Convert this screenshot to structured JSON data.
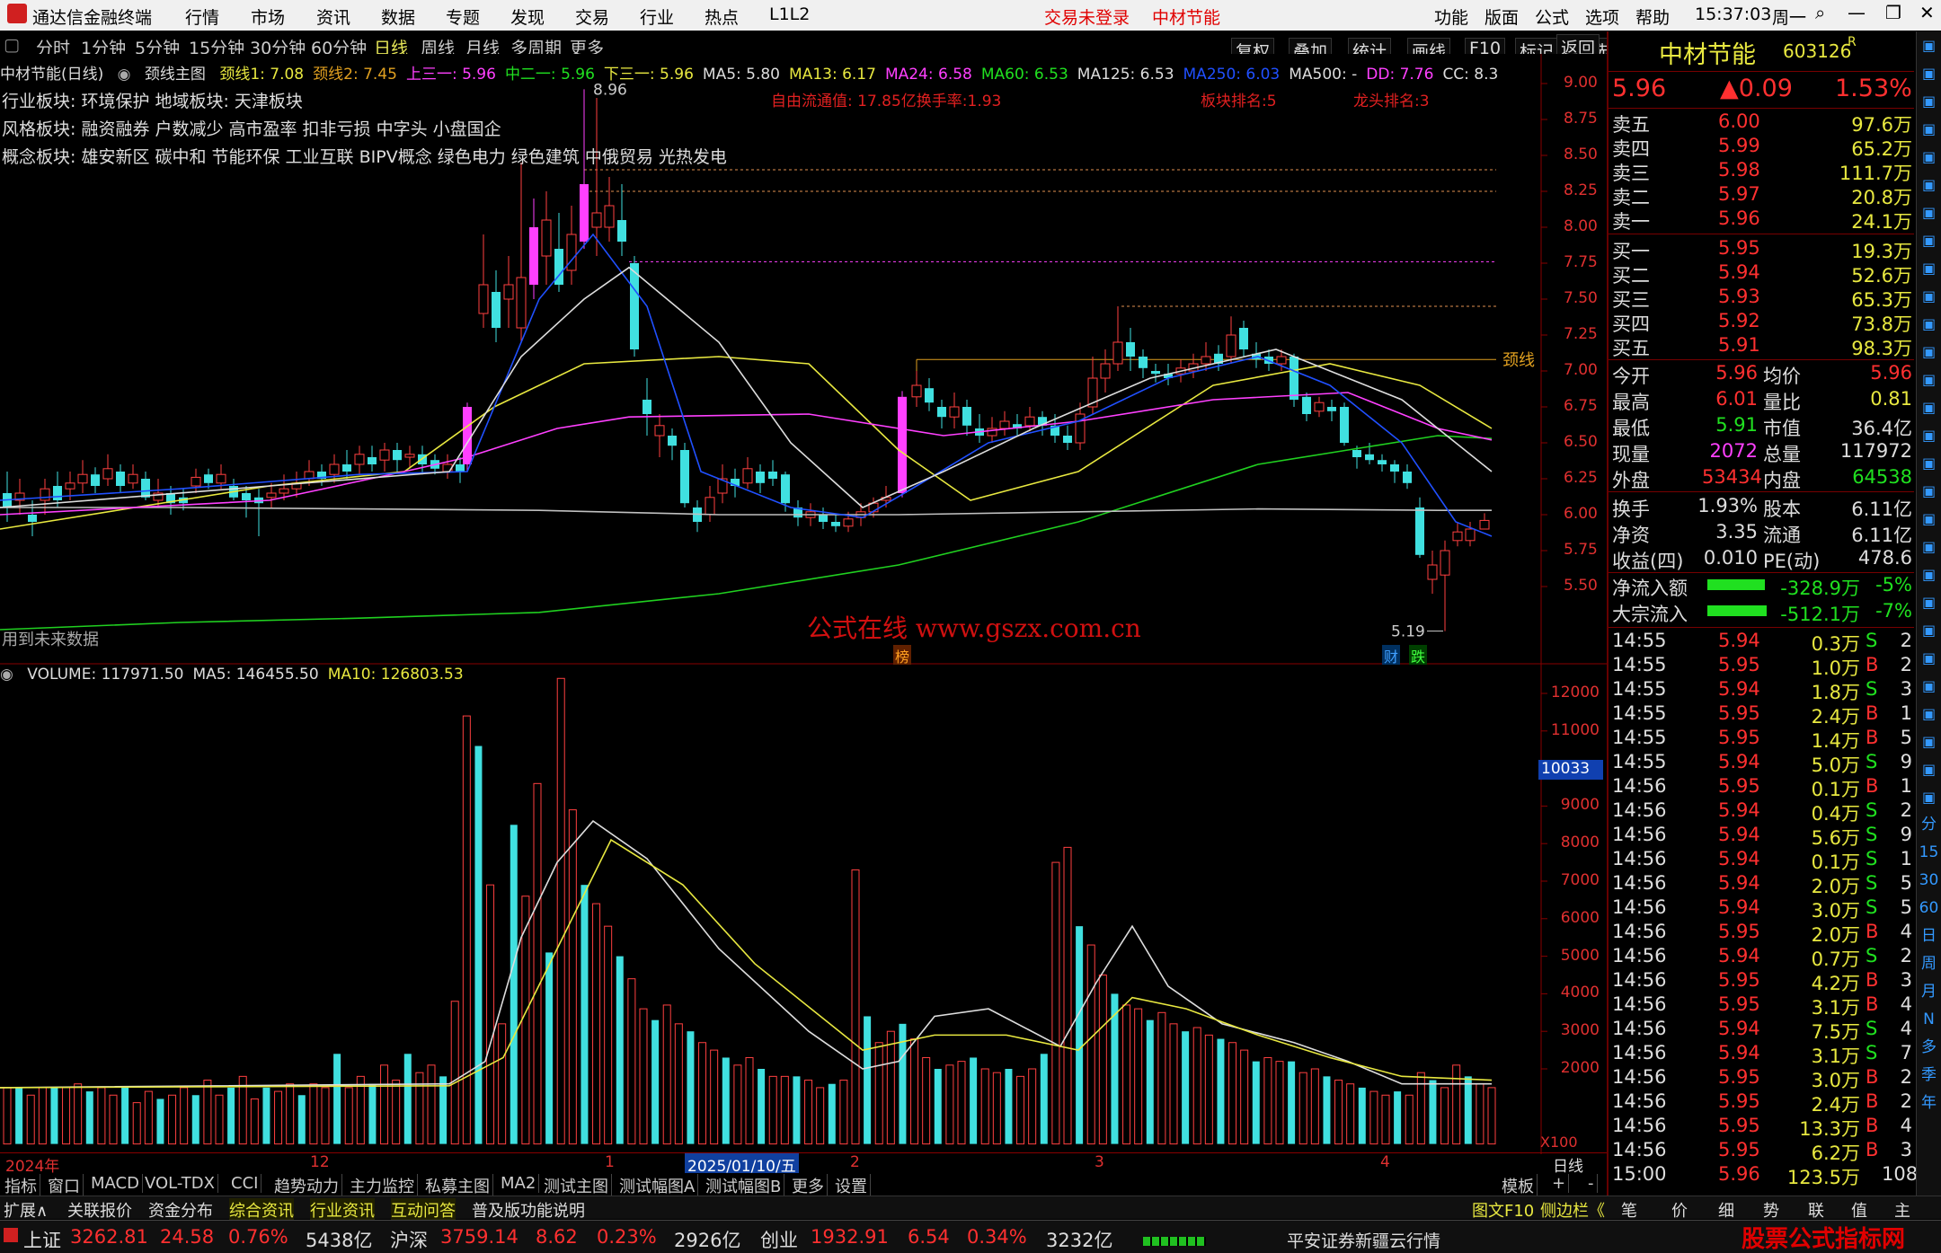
{
  "titlebar": {
    "app": "通达信金融终端",
    "menu": [
      "行情",
      "市场",
      "资讯",
      "数据",
      "专题",
      "发现",
      "交易",
      "行业",
      "热点",
      "L1L2"
    ],
    "notice": "交易未登录",
    "stock": "中材节能",
    "right_menu": [
      "功能",
      "版面",
      "公式",
      "选项",
      "帮助"
    ],
    "time": "15:37:03",
    "weekday": "周一"
  },
  "periods": [
    "分时",
    "1分钟",
    "5分钟",
    "15分钟",
    "30分钟",
    "60分钟",
    "日线",
    "周线",
    "月线",
    "多周期",
    "更多"
  ],
  "tools": [
    "复权",
    "叠加",
    "统计",
    "画线",
    "F10",
    "标记",
    "-自选",
    "返回"
  ],
  "chart_title": "中材节能(日线)",
  "indicator_name": "颈线主图",
  "ma_values": [
    {
      "t": "颈线1: 7.08",
      "c": "#e8e840"
    },
    {
      "t": "颈线2: 7.45",
      "c": "#e0a020"
    },
    {
      "t": "上三一: 5.96",
      "c": "#ff40ff"
    },
    {
      "t": "中二一: 5.96",
      "c": "#20e020"
    },
    {
      "t": "下三一: 5.96",
      "c": "#e8e840"
    },
    {
      "t": "MA5: 5.80",
      "c": "#dddddd"
    },
    {
      "t": "MA13: 6.17",
      "c": "#e8e840"
    },
    {
      "t": "MA24: 6.58",
      "c": "#ff40ff"
    },
    {
      "t": "MA60: 6.53",
      "c": "#20e020"
    },
    {
      "t": "MA125: 6.53",
      "c": "#dddddd"
    },
    {
      "t": "MA250: 6.03",
      "c": "#2050ff"
    },
    {
      "t": "MA500: -",
      "c": "#dddddd"
    },
    {
      "t": "DD: 7.76",
      "c": "#ff40ff"
    },
    {
      "t": "CC: 8.3",
      "c": "#dddddd"
    }
  ],
  "sectors": {
    "industry": "行业板块: 环境保护    地域板块: 天津板块",
    "style": "风格板块: 融资融券 户数减少 高市盈率 扣非亏损 中字头 小盘国企",
    "concept": "概念板块: 雄安新区 碳中和 节能环保 工业互联 BIPV概念 绿色电力 绿色建筑 中俄贸易 光热发电"
  },
  "capital_info": {
    "float": "自由流通值: 17.85亿换手率:1.93",
    "sector_rank": "板块排名:5",
    "leader_rank": "龙头排名:3"
  },
  "price_axis": [
    "9.00",
    "8.75",
    "8.50",
    "8.25",
    "8.00",
    "7.75",
    "7.50",
    "7.25",
    "7.00",
    "6.75",
    "6.50",
    "6.25",
    "6.00",
    "5.75",
    "5.50"
  ],
  "high_label": "8.96",
  "low_label": "5.19",
  "neckline_label": "颈线",
  "watermark": "公式在线  www.gszx.com.cn",
  "future_data": "用到未来数据",
  "markers": {
    "bang": "榜",
    "cai": "财",
    "die": "跌"
  },
  "volume": {
    "header": [
      {
        "t": "VOLUME: 117971.50",
        "c": "#dddddd"
      },
      {
        "t": "MA5: 146455.50",
        "c": "#dddddd"
      },
      {
        "t": "MA10: 126803.53",
        "c": "#e8e840"
      }
    ],
    "axis": [
      "12000",
      "11000",
      "10000",
      "9000",
      "8000",
      "7000",
      "6000",
      "5000",
      "4000",
      "3000",
      "2000"
    ],
    "current": "10033",
    "unit": "X100"
  },
  "xaxis": {
    "y2024": "2024年",
    "m12": "12",
    "m1": "1",
    "cursor_date": "2025/01/10/五",
    "m2": "2",
    "m3": "3",
    "m4": "4",
    "period": "日线"
  },
  "tabs1": [
    "指标",
    "窗口",
    "MACD",
    "VOL-TDX",
    "CCI",
    "趋势动力",
    "主力监控",
    "私募主图",
    "MA2",
    "测试主图",
    "测试幅图A",
    "测试幅图B",
    "更多",
    "设置"
  ],
  "tabs1_right": [
    "模板",
    "+",
    "-"
  ],
  "tabs2": [
    "扩展∧",
    "关联报价",
    "资金分布",
    "综合资讯",
    "行业资讯",
    "互动问答",
    "普及版功能说明"
  ],
  "tabs2_right": [
    "图文F10",
    "侧边栏《",
    "笔",
    "价",
    "细",
    "势",
    "联",
    "值",
    "主"
  ],
  "status": {
    "sh_name": "上证",
    "sh_val": "3262.81",
    "sh_chg": "24.58",
    "sh_pct": "0.76%",
    "sh_amt": "5438亿",
    "sz_name": "沪深",
    "sz_val": "3759.14",
    "sz_chg": "8.62",
    "sz_pct": "0.23%",
    "sz_amt": "2926亿",
    "cy_name": "创业",
    "cy_val": "1932.91",
    "cy_chg": "6.54",
    "cy_pct": "0.34%",
    "cy_amt": "3232亿",
    "broker": "平安证券新疆云行情",
    "site": "股票公式指标网",
    "site_url": "www.gszx.com.cn"
  },
  "quote": {
    "name": "中材节能",
    "code": "603126",
    "flag": "R",
    "price": "5.96",
    "change": "▲0.09",
    "pct": "1.53%",
    "sell": [
      {
        "l": "卖五",
        "p": "6.00",
        "v": "97.6万"
      },
      {
        "l": "卖四",
        "p": "5.99",
        "v": "65.2万"
      },
      {
        "l": "卖三",
        "p": "5.98",
        "v": "111.7万"
      },
      {
        "l": "卖二",
        "p": "5.97",
        "v": "20.8万"
      },
      {
        "l": "卖一",
        "p": "5.96",
        "v": "24.1万"
      }
    ],
    "buy": [
      {
        "l": "买一",
        "p": "5.95",
        "v": "19.3万"
      },
      {
        "l": "买二",
        "p": "5.94",
        "v": "52.6万"
      },
      {
        "l": "买三",
        "p": "5.93",
        "v": "65.3万"
      },
      {
        "l": "买四",
        "p": "5.92",
        "v": "73.8万"
      },
      {
        "l": "买五",
        "p": "5.91",
        "v": "98.3万"
      }
    ],
    "stats": [
      [
        "今开",
        "5.96",
        "均价",
        "5.96"
      ],
      [
        "最高",
        "6.01",
        "量比",
        "0.81"
      ],
      [
        "最低",
        "5.91",
        "市值",
        "36.4亿"
      ],
      [
        "现量",
        "2072",
        "总量",
        "117972"
      ],
      [
        "外盘",
        "53434",
        "内盘",
        "64538"
      ]
    ],
    "stats2": [
      [
        "换手",
        "1.93%",
        "股本",
        "6.11亿"
      ],
      [
        "净资",
        "3.35",
        "流通",
        "6.11亿"
      ],
      [
        "收益(四)",
        "0.010",
        "PE(动)",
        "478.6"
      ]
    ],
    "flow": [
      {
        "l": "净流入额",
        "v": "-328.9万",
        "p": "-5%"
      },
      {
        "l": "大宗流入",
        "v": "-512.1万",
        "p": "-7%"
      }
    ],
    "ticks": [
      [
        "14:55",
        "5.94",
        "0.3万",
        "S",
        "2"
      ],
      [
        "14:55",
        "5.95",
        "1.0万",
        "B",
        "2"
      ],
      [
        "14:55",
        "5.94",
        "1.8万",
        "S",
        "3"
      ],
      [
        "14:55",
        "5.95",
        "2.4万",
        "B",
        "1"
      ],
      [
        "14:55",
        "5.95",
        "1.4万",
        "B",
        "5"
      ],
      [
        "14:55",
        "5.94",
        "5.0万",
        "S",
        "9"
      ],
      [
        "14:56",
        "5.95",
        "0.1万",
        "B",
        "1"
      ],
      [
        "14:56",
        "5.94",
        "0.4万",
        "S",
        "2"
      ],
      [
        "14:56",
        "5.94",
        "5.6万",
        "S",
        "9"
      ],
      [
        "14:56",
        "5.94",
        "0.1万",
        "S",
        "1"
      ],
      [
        "14:56",
        "5.94",
        "2.0万",
        "S",
        "5"
      ],
      [
        "14:56",
        "5.94",
        "3.0万",
        "S",
        "5"
      ],
      [
        "14:56",
        "5.95",
        "2.0万",
        "B",
        "4"
      ],
      [
        "14:56",
        "5.94",
        "0.7万",
        "S",
        "2"
      ],
      [
        "14:56",
        "5.95",
        "4.2万",
        "B",
        "3"
      ],
      [
        "14:56",
        "5.95",
        "3.1万",
        "B",
        "4"
      ],
      [
        "14:56",
        "5.94",
        "7.5万",
        "S",
        "4"
      ],
      [
        "14:56",
        "5.94",
        "3.1万",
        "S",
        "7"
      ],
      [
        "14:56",
        "5.95",
        "3.0万",
        "B",
        "2"
      ],
      [
        "14:56",
        "5.95",
        "2.4万",
        "B",
        "2"
      ],
      [
        "14:56",
        "5.95",
        "13.3万",
        "B",
        "4"
      ],
      [
        "14:56",
        "5.95",
        "6.2万",
        "B",
        "3"
      ],
      [
        "15:00",
        "5.96",
        "123.5万",
        "",
        "108"
      ]
    ]
  },
  "sidebar_icons": [
    "分",
    "15",
    "30",
    "60",
    "日",
    "周",
    "月",
    "N",
    "多",
    "季",
    "年"
  ]
}
